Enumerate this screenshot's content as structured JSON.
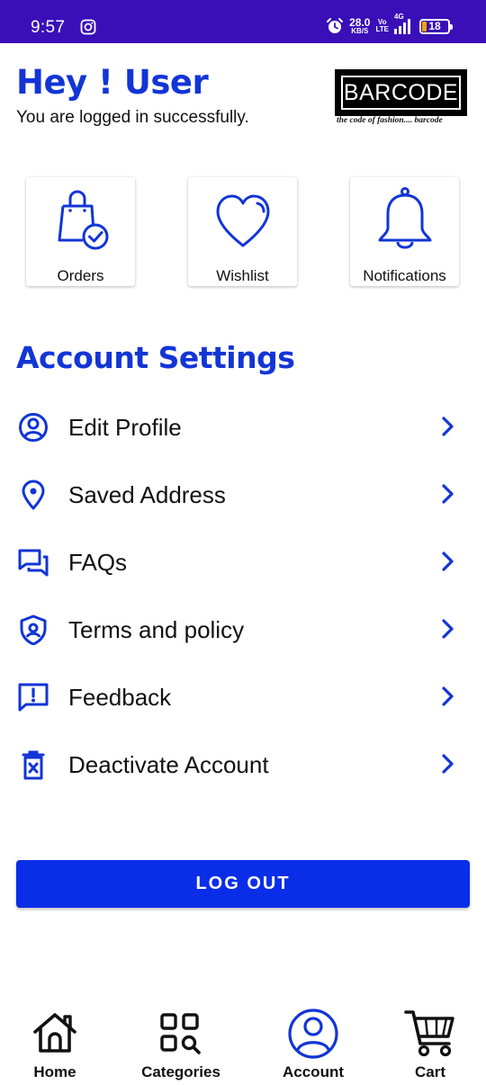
{
  "status_bar": {
    "time": "9:57",
    "speed_value": "28.0",
    "speed_unit": "KB/S",
    "volte_top": "Vo",
    "volte_bottom": "LTE",
    "network": "4G",
    "battery": "18",
    "battery_level": 0.18,
    "color": "#3a0fb8"
  },
  "header": {
    "greeting": "Hey ! User",
    "subtitle": "You are logged in successfully.",
    "logo_text": "BARCODE",
    "logo_tagline": "the code of fashion.... barcode"
  },
  "tiles": [
    {
      "label": "Orders",
      "icon": "shopping-bag-check-icon"
    },
    {
      "label": "Wishlist",
      "icon": "heart-icon"
    },
    {
      "label": "Notifications",
      "icon": "bell-icon"
    }
  ],
  "account_settings": {
    "title": "Account Settings",
    "items": [
      {
        "label": "Edit Profile",
        "icon": "user-circle-icon"
      },
      {
        "label": "Saved Address",
        "icon": "location-pin-icon"
      },
      {
        "label": "FAQs",
        "icon": "chat-bubbles-icon"
      },
      {
        "label": "Terms and policy",
        "icon": "shield-user-icon"
      },
      {
        "label": "Feedback",
        "icon": "feedback-alert-icon"
      },
      {
        "label": "Deactivate Account",
        "icon": "trash-x-icon"
      }
    ]
  },
  "logout_label": "LOG OUT",
  "bottom_nav": [
    {
      "label": "Home",
      "icon": "home-icon"
    },
    {
      "label": "Categories",
      "icon": "categories-grid-icon"
    },
    {
      "label": "Account",
      "icon": "account-circle-icon",
      "active": true
    },
    {
      "label": "Cart",
      "icon": "cart-icon"
    }
  ],
  "colors": {
    "accent": "#1235d6",
    "button": "#0a2ee8",
    "status_bar": "#3a0fb8"
  }
}
